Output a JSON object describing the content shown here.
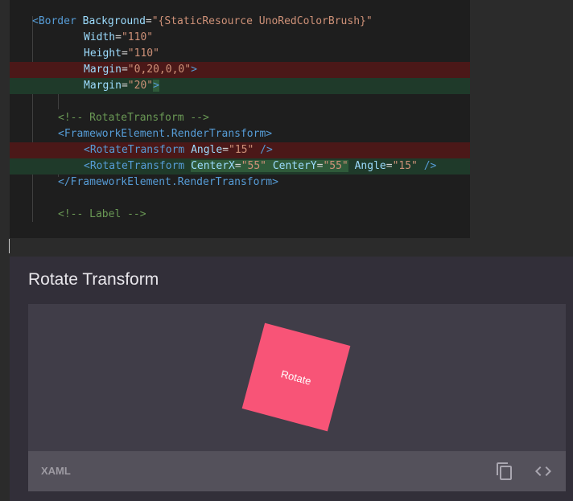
{
  "editor": {
    "lines": [
      {
        "kind": "context",
        "indent": 0,
        "parts": [
          {
            "c": "ctag",
            "t": "<"
          },
          {
            "c": "ctag",
            "t": "Border"
          },
          {
            "c": "ctext",
            "t": " "
          },
          {
            "c": "cattr",
            "t": "Background"
          },
          {
            "c": "ctext",
            "t": "="
          },
          {
            "c": "cval",
            "t": "\"{StaticResource UnoRedColorBrush}\""
          }
        ]
      },
      {
        "kind": "context",
        "indent": 8,
        "parts": [
          {
            "c": "cattr",
            "t": "Width"
          },
          {
            "c": "ctext",
            "t": "="
          },
          {
            "c": "cval",
            "t": "\"110\""
          }
        ]
      },
      {
        "kind": "context",
        "indent": 8,
        "parts": [
          {
            "c": "cattr",
            "t": "Height"
          },
          {
            "c": "ctext",
            "t": "="
          },
          {
            "c": "cval",
            "t": "\"110\""
          }
        ]
      },
      {
        "kind": "removed",
        "indent": 8,
        "parts": [
          {
            "c": "cattr",
            "t": "Margin"
          },
          {
            "c": "ctext",
            "t": "="
          },
          {
            "c": "cval",
            "t": "\"0,20,0,0\""
          },
          {
            "c": "ctag",
            "t": ">"
          }
        ]
      },
      {
        "kind": "added",
        "indent": 8,
        "parts": [
          {
            "c": "cattr",
            "t": "Margin"
          },
          {
            "c": "ctext",
            "t": "="
          },
          {
            "c": "cval",
            "t": "\"20\""
          },
          {
            "c": "ctag hl-add",
            "t": ">"
          }
        ]
      },
      {
        "kind": "context",
        "indent": 0,
        "parts": []
      },
      {
        "kind": "context",
        "indent": 4,
        "parts": [
          {
            "c": "ccomment",
            "t": "<!-- RotateTransform -->"
          }
        ]
      },
      {
        "kind": "context",
        "indent": 4,
        "parts": [
          {
            "c": "ctag",
            "t": "<FrameworkElement.RenderTransform>"
          }
        ]
      },
      {
        "kind": "removed",
        "indent": 8,
        "parts": [
          {
            "c": "ctag",
            "t": "<RotateTransform"
          },
          {
            "c": "ctext",
            "t": " "
          },
          {
            "c": "cattr",
            "t": "Angle"
          },
          {
            "c": "ctext",
            "t": "="
          },
          {
            "c": "cval",
            "t": "\"15\""
          },
          {
            "c": "ctext",
            "t": " "
          },
          {
            "c": "ctag",
            "t": "/>"
          }
        ]
      },
      {
        "kind": "added",
        "indent": 8,
        "parts": [
          {
            "c": "ctag",
            "t": "<RotateTransform"
          },
          {
            "c": "ctext",
            "t": " "
          },
          {
            "c": "cattr hl-add",
            "t": "CenterX"
          },
          {
            "c": "ctext hl-add",
            "t": "="
          },
          {
            "c": "cval hl-add",
            "t": "\"55\""
          },
          {
            "c": "ctext hl-add",
            "t": " "
          },
          {
            "c": "cattr hl-add",
            "t": "CenterY"
          },
          {
            "c": "ctext hl-add",
            "t": "="
          },
          {
            "c": "cval hl-add",
            "t": "\"55\""
          },
          {
            "c": "ctext",
            "t": " "
          },
          {
            "c": "cattr",
            "t": "Angle"
          },
          {
            "c": "ctext",
            "t": "="
          },
          {
            "c": "cval",
            "t": "\"15\""
          },
          {
            "c": "ctext",
            "t": " "
          },
          {
            "c": "ctag",
            "t": "/>"
          }
        ]
      },
      {
        "kind": "context",
        "indent": 4,
        "parts": [
          {
            "c": "ctag",
            "t": "</FrameworkElement.RenderTransform>"
          }
        ]
      },
      {
        "kind": "context",
        "indent": 0,
        "parts": []
      },
      {
        "kind": "context",
        "indent": 4,
        "parts": [
          {
            "c": "ccomment",
            "t": "<!-- Label -->"
          }
        ]
      }
    ]
  },
  "preview_card": {
    "title": "Rotate Transform",
    "sample_label": "Rotate",
    "footer_label": "XAML",
    "icons": [
      "copy-icon",
      "code-icon"
    ],
    "colors": {
      "sample_fill": "#f85477",
      "card_bg": "#322f39",
      "preview_bg": "#403d48",
      "footer_bg": "#54515b"
    }
  }
}
